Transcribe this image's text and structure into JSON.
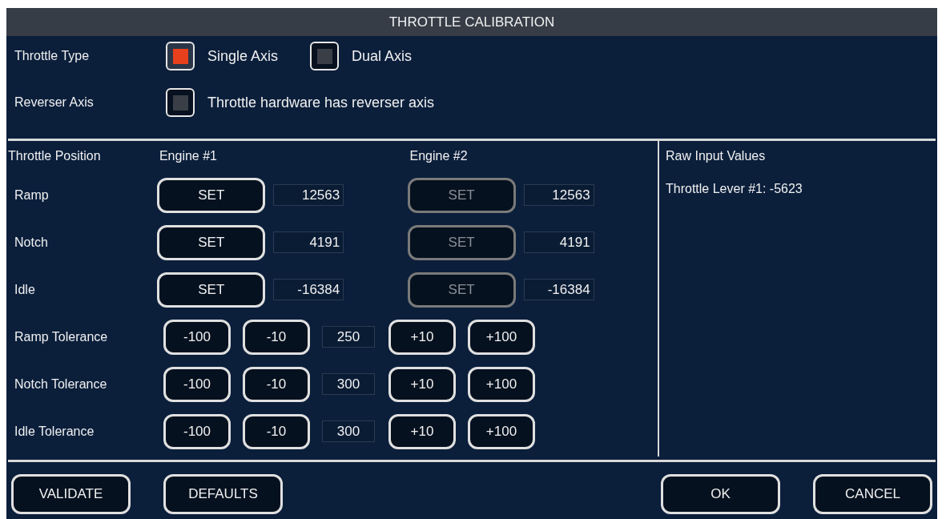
{
  "window": {
    "title": "THROTTLE CALIBRATION"
  },
  "throttle_type": {
    "label": "Throttle Type",
    "options": [
      {
        "label": "Single Axis",
        "selected": true
      },
      {
        "label": "Dual Axis",
        "selected": false
      }
    ]
  },
  "reverser_axis": {
    "label": "Reverser Axis",
    "option": {
      "label": "Throttle hardware has reverser axis",
      "checked": false
    }
  },
  "positions": {
    "heading": "Throttle Position",
    "engines": [
      "Engine #1",
      "Engine #2"
    ],
    "rows": [
      {
        "label": "Ramp",
        "engines": [
          {
            "button": "SET",
            "disabled": false,
            "value": "12563"
          },
          {
            "button": "SET",
            "disabled": true,
            "value": "12563"
          }
        ]
      },
      {
        "label": "Notch",
        "engines": [
          {
            "button": "SET",
            "disabled": false,
            "value": "4191"
          },
          {
            "button": "SET",
            "disabled": true,
            "value": "4191"
          }
        ]
      },
      {
        "label": "Idle",
        "engines": [
          {
            "button": "SET",
            "disabled": false,
            "value": "-16384"
          },
          {
            "button": "SET",
            "disabled": true,
            "value": "-16384"
          }
        ]
      }
    ]
  },
  "tolerances": [
    {
      "label": "Ramp Tolerance",
      "decrease": [
        "-100",
        "-10"
      ],
      "value": "250",
      "increase": [
        "+10",
        "+100"
      ]
    },
    {
      "label": "Notch Tolerance",
      "decrease": [
        "-100",
        "-10"
      ],
      "value": "300",
      "increase": [
        "+10",
        "+100"
      ]
    },
    {
      "label": "Idle Tolerance",
      "decrease": [
        "-100",
        "-10"
      ],
      "value": "300",
      "increase": [
        "+10",
        "+100"
      ]
    }
  ],
  "raw_input": {
    "heading": "Raw Input Values",
    "lines": [
      "Throttle Lever #1: -5623"
    ]
  },
  "footer": {
    "left_buttons": [
      "VALIDATE",
      "DEFAULTS"
    ],
    "right_buttons": [
      "OK",
      "CANCEL"
    ]
  }
}
